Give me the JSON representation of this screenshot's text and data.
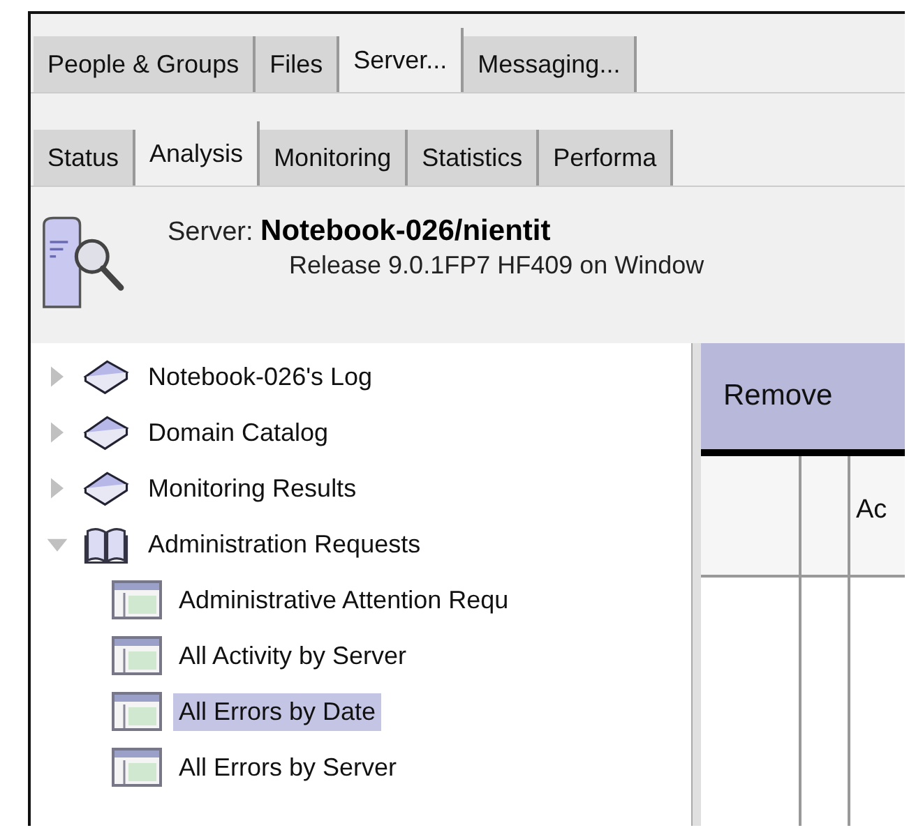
{
  "main_tabs": [
    {
      "label": "People & Groups",
      "selected": false
    },
    {
      "label": "Files",
      "selected": false
    },
    {
      "label": "Server...",
      "selected": true
    },
    {
      "label": "Messaging...",
      "selected": false
    }
  ],
  "sub_tabs": [
    {
      "label": "Status",
      "selected": false
    },
    {
      "label": "Analysis",
      "selected": true
    },
    {
      "label": "Monitoring",
      "selected": false
    },
    {
      "label": "Statistics",
      "selected": false
    },
    {
      "label": "Performa",
      "selected": false
    }
  ],
  "server": {
    "label": "Server:",
    "name": "Notebook-026/nientit",
    "release": "Release 9.0.1FP7 HF409 on Window"
  },
  "tree": [
    {
      "label": "Notebook-026's Log",
      "kind": "folder",
      "expanded": false,
      "selected": false
    },
    {
      "label": "Domain Catalog",
      "kind": "folder",
      "expanded": false,
      "selected": false
    },
    {
      "label": "Monitoring Results",
      "kind": "folder",
      "expanded": false,
      "selected": false
    },
    {
      "label": "Administration Requests",
      "kind": "folder",
      "expanded": true,
      "selected": false,
      "children": [
        {
          "label": "Administrative Attention Requ",
          "kind": "view",
          "selected": false
        },
        {
          "label": "All Activity by Server",
          "kind": "view",
          "selected": false
        },
        {
          "label": "All Errors by Date",
          "kind": "view",
          "selected": true
        },
        {
          "label": "All Errors by Server",
          "kind": "view",
          "selected": false
        }
      ]
    }
  ],
  "action_button": "Remove",
  "grid": {
    "column_3": "Ac"
  }
}
